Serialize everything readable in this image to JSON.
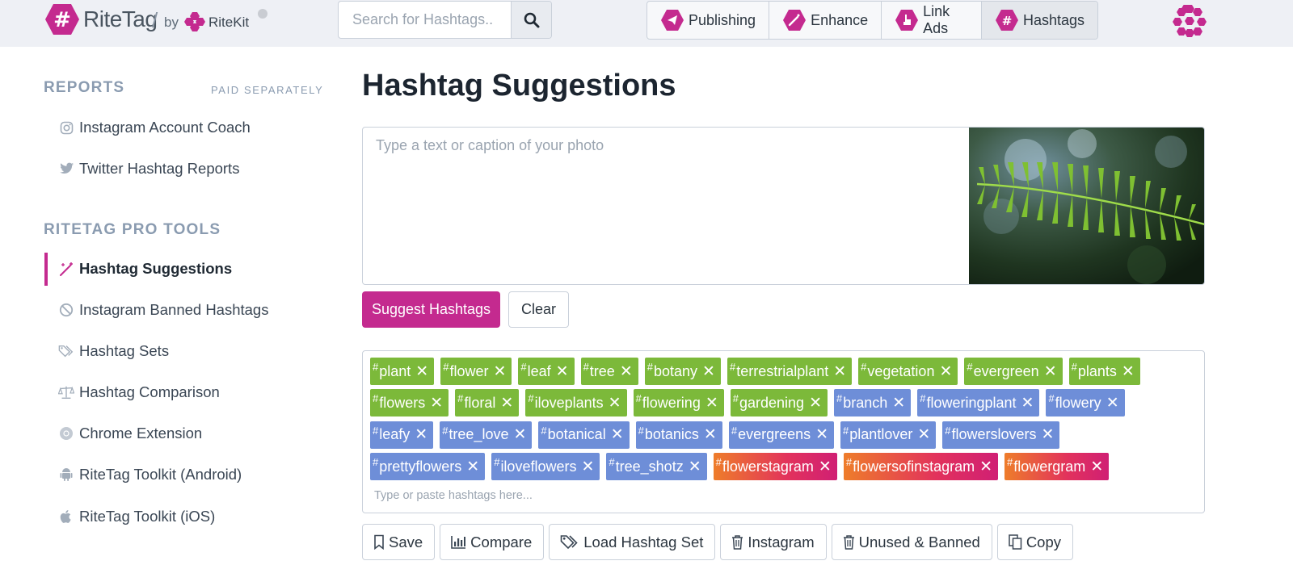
{
  "brand": {
    "name": "RiteTag",
    "slash": "/",
    "by": "by",
    "parent": "RiteKit",
    "accent": "#c42a8f"
  },
  "search": {
    "placeholder": "Search for Hashtags.."
  },
  "nav": [
    {
      "label": "Publishing",
      "icon": "paper-plane-icon"
    },
    {
      "label": "Enhance",
      "icon": "magic-wand-icon"
    },
    {
      "label": "Link Ads",
      "icon": "pointer-hand-icon"
    },
    {
      "label": "Hashtags",
      "icon": "hashtag-icon",
      "active": true
    }
  ],
  "sidebar": {
    "reports_heading": "REPORTS",
    "paid_label": "PAID SEPARATELY",
    "reports": [
      {
        "label": "Instagram Account Coach",
        "icon": "instagram-icon"
      },
      {
        "label": "Twitter Hashtag Reports",
        "icon": "twitter-icon"
      }
    ],
    "tools_heading": "RITETAG PRO TOOLS",
    "tools": [
      {
        "label": "Hashtag Suggestions",
        "icon": "magic-wand-icon",
        "active": true
      },
      {
        "label": "Instagram Banned Hashtags",
        "icon": "ban-icon"
      },
      {
        "label": "Hashtag Sets",
        "icon": "tags-icon"
      },
      {
        "label": "Hashtag Comparison",
        "icon": "balance-scale-icon"
      },
      {
        "label": "Chrome Extension",
        "icon": "chrome-icon"
      },
      {
        "label": "RiteTag Toolkit (Android)",
        "icon": "android-icon"
      },
      {
        "label": "RiteTag Toolkit (iOS)",
        "icon": "apple-icon"
      }
    ]
  },
  "main": {
    "title": "Hashtag Suggestions",
    "caption_placeholder": "Type a text or caption of your photo",
    "suggest_label": "Suggest Hashtags",
    "clear_label": "Clear",
    "tag_input_placeholder": "Type or paste hashtags here...",
    "tag_colors": {
      "green": "#7cb93a",
      "blue": "#6e8ed8",
      "gradient_start": "#ee7d2a",
      "gradient_end": "#d01f74"
    },
    "tag_rows": [
      [
        {
          "text": "plant",
          "color": "green"
        },
        {
          "text": "flower",
          "color": "green"
        },
        {
          "text": "leaf",
          "color": "green"
        },
        {
          "text": "tree",
          "color": "green"
        },
        {
          "text": "botany",
          "color": "green"
        },
        {
          "text": "terrestrialplant",
          "color": "green"
        },
        {
          "text": "vegetation",
          "color": "green"
        },
        {
          "text": "evergreen",
          "color": "green"
        },
        {
          "text": "plants",
          "color": "green"
        }
      ],
      [
        {
          "text": "flowers",
          "color": "green"
        },
        {
          "text": "floral",
          "color": "green"
        },
        {
          "text": "iloveplants",
          "color": "green"
        },
        {
          "text": "flowering",
          "color": "green"
        },
        {
          "text": "gardening",
          "color": "green"
        },
        {
          "text": "branch",
          "color": "blue"
        },
        {
          "text": "floweringplant",
          "color": "blue"
        },
        {
          "text": "flowery",
          "color": "blue"
        }
      ],
      [
        {
          "text": "leafy",
          "color": "blue"
        },
        {
          "text": "tree_love",
          "color": "blue"
        },
        {
          "text": "botanical",
          "color": "blue"
        },
        {
          "text": "botanics",
          "color": "blue"
        },
        {
          "text": "evergreens",
          "color": "blue"
        },
        {
          "text": "plantlover",
          "color": "blue"
        },
        {
          "text": "flowerslovers",
          "color": "blue"
        }
      ],
      [
        {
          "text": "prettyflowers",
          "color": "blue"
        },
        {
          "text": "iloveflowers",
          "color": "blue"
        },
        {
          "text": "tree_shotz",
          "color": "blue"
        },
        {
          "text": "flowerstagram",
          "color": "grad"
        },
        {
          "text": "flowersofinstagram",
          "color": "grad"
        },
        {
          "text": "flowergram",
          "color": "grad"
        }
      ]
    ],
    "actions": [
      {
        "label": "Save",
        "icon": "bookmark-icon"
      },
      {
        "label": "Compare",
        "icon": "bar-chart-icon"
      },
      {
        "label": "Load Hashtag Set",
        "icon": "tags-icon"
      },
      {
        "label": "Instagram",
        "icon": "trash-icon"
      },
      {
        "label": "Unused & Banned",
        "icon": "trash-icon"
      },
      {
        "label": "Copy",
        "icon": "copy-icon"
      }
    ]
  }
}
